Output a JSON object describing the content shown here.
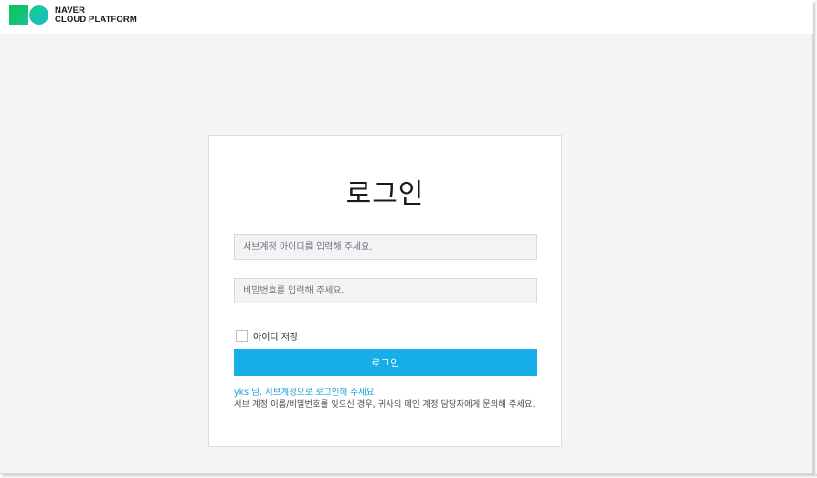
{
  "brand": {
    "line1": "NAVER",
    "line2": "CLOUD PLATFORM",
    "colors": {
      "square": "#03c75a",
      "circle": "#1ab8c9"
    }
  },
  "login": {
    "title": "로그인",
    "id_placeholder": "서브계정 아이디를 입력해 주세요.",
    "pw_placeholder": "비밀번호를 입력해 주세요.",
    "remember_label": "아이디 저장",
    "button_label": "로그인",
    "subaccount_notice": "yks 님, 서브계정으로 로그인해 주세요",
    "help_text": "서브 계정 이름/비밀번호를 잊으신 경우, 귀사의 메인 계정 담당자에게 문의해 주세요.",
    "accent_color": "#16aee8"
  }
}
